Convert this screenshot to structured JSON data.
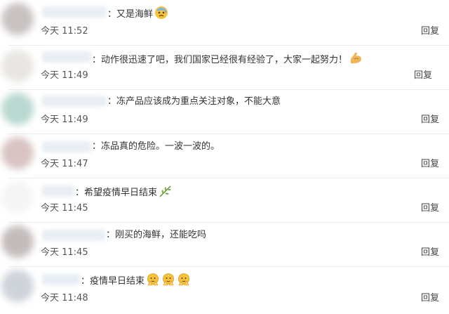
{
  "comments": [
    {
      "text": "：又是海鲜",
      "time": "今天 11:52",
      "reply": "回复",
      "avatar_color": "#c9c2c2"
    },
    {
      "text": "：动作很迅速了吧，我们国家已经很有经验了，大家一起努力！",
      "time": "今天 11:49",
      "reply": "回复",
      "avatar_color": "#e3e0dc"
    },
    {
      "text": "：冻产品应该成为重点关注对象，不能大意",
      "time": "今天 11:49",
      "reply": "回复",
      "avatar_color": "#b9d8d0"
    },
    {
      "text": "：冻品真的危险。一波一波的。",
      "time": "今天 11:47",
      "reply": "回复",
      "avatar_color": "#d9c3c3"
    },
    {
      "text": "：希望疫情早日结束",
      "time": "今天 11:45",
      "reply": "回复",
      "avatar_color": "#ffffff"
    },
    {
      "text": "：刚买的海鲜，还能吃吗",
      "time": "今天 11:45",
      "reply": "回复",
      "avatar_color": "#c4bcbc"
    },
    {
      "text": "：疫情早日结束",
      "time": "今天 11:48",
      "reply": "回复",
      "avatar_color": "#cfd3da"
    }
  ],
  "icons": {
    "c0": [
      "sweat-face-icon"
    ],
    "c1": [
      "flexed-biceps-icon"
    ],
    "c4": [
      "leaf-icon"
    ],
    "c6": [
      "pray-face-icon",
      "pray-face-icon",
      "pray-face-icon"
    ]
  }
}
